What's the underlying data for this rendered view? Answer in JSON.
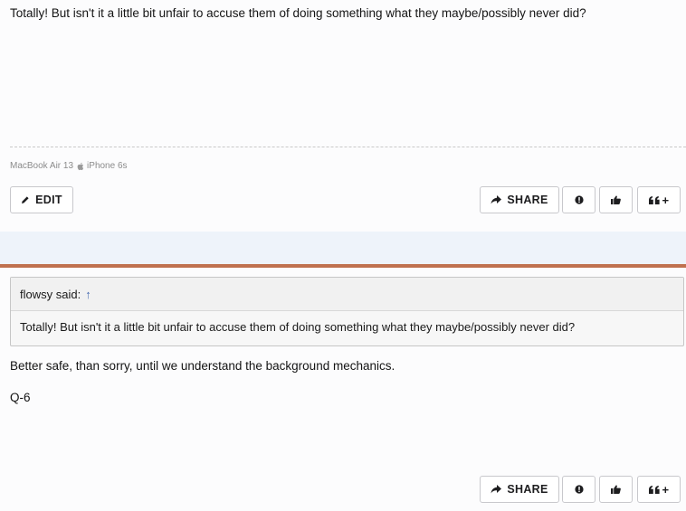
{
  "post1": {
    "body": "Totally! But isn't it a little bit unfair to accuse them of doing something what they maybe/possibly never did?",
    "signature_device1": "MacBook Air 13",
    "signature_device2": "iPhone 6s",
    "actions": {
      "edit_label": "EDIT",
      "share_label": "SHARE",
      "quote_label": "+"
    }
  },
  "post2": {
    "quote": {
      "author": "flowsy said:",
      "arrow": "↑",
      "text": "Totally! But isn't it a little bit unfair to accuse them of doing something what they maybe/possibly never did?"
    },
    "lines": [
      "Better safe, than sorry, until we understand the background mechanics.",
      "Q-6"
    ],
    "actions": {
      "share_label": "SHARE",
      "quote_label": "+"
    }
  },
  "icons": [
    "pencil-icon",
    "share-icon",
    "report-icon",
    "thumbs-up-icon",
    "quote-icon",
    "apple-icon"
  ],
  "colors": {
    "accent_line": "#c0714f",
    "band": "#eef3fa",
    "link": "#4a6fb3"
  }
}
